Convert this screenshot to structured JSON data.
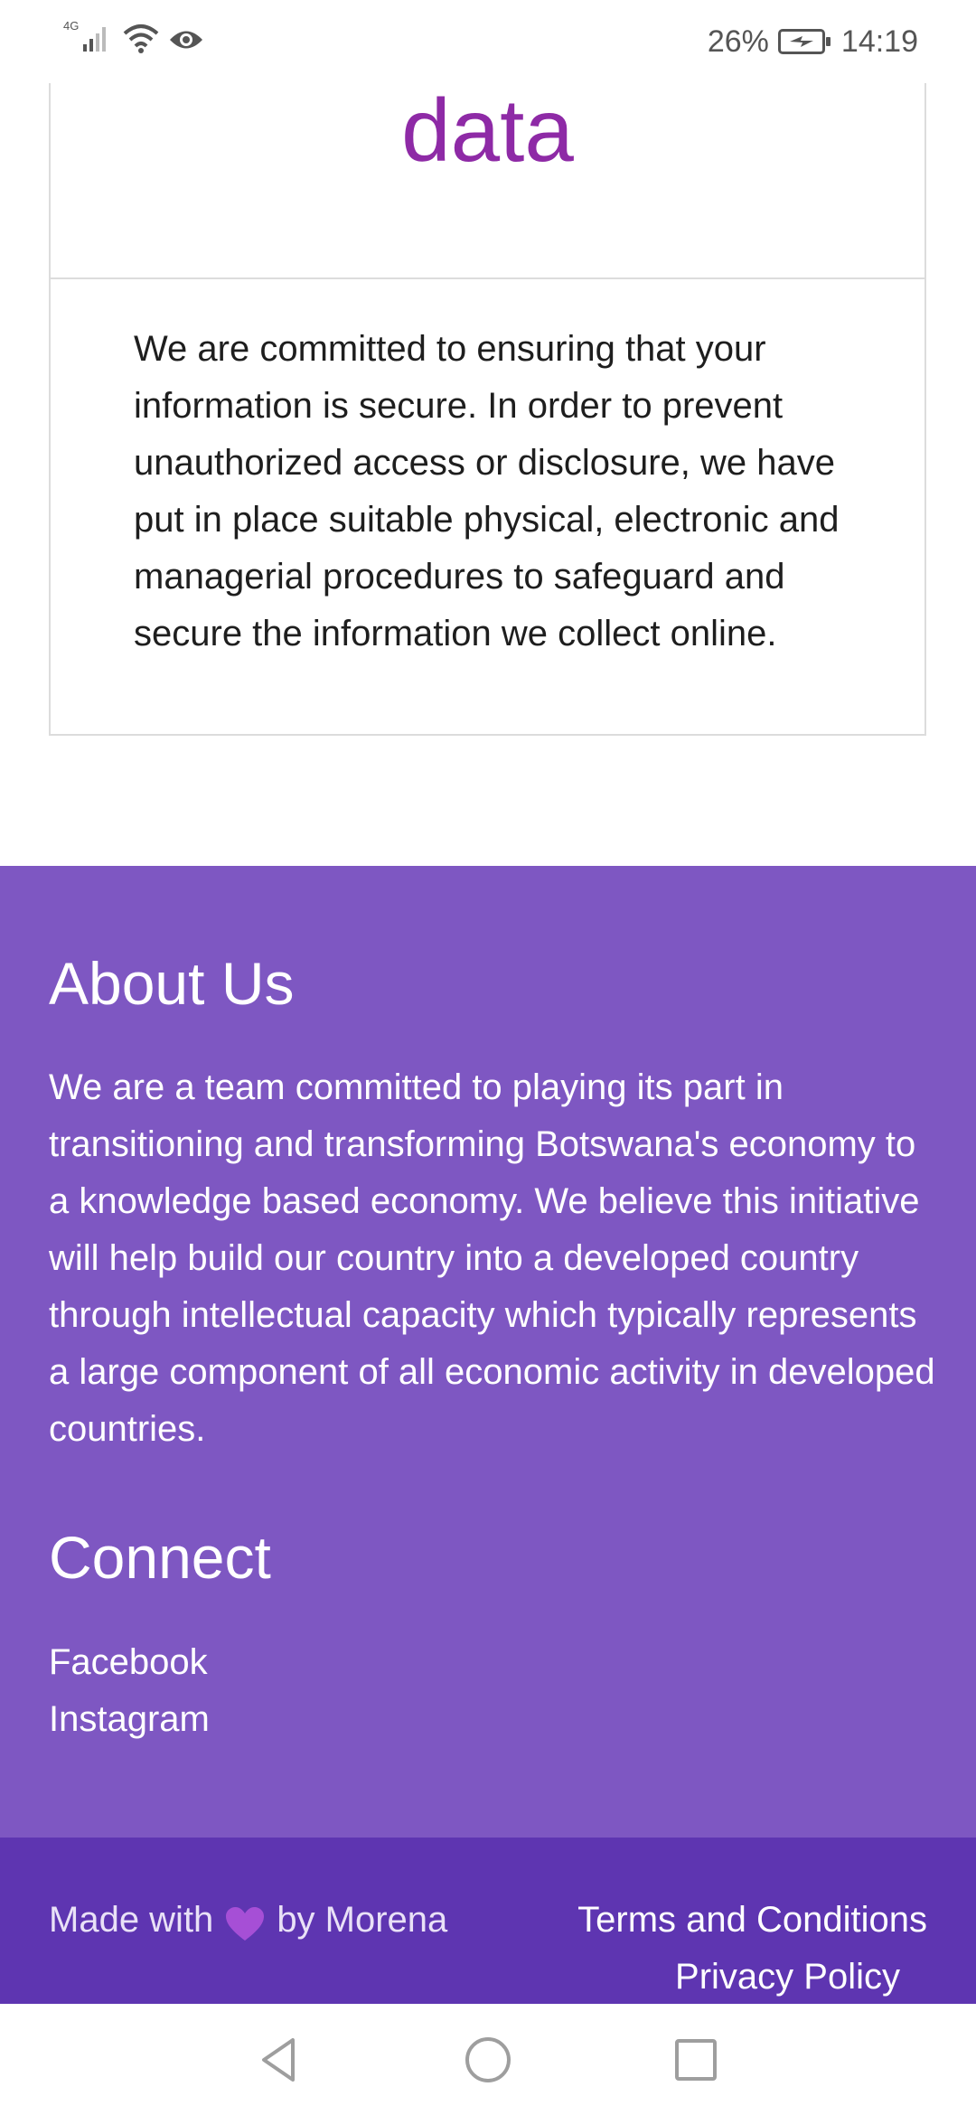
{
  "status_bar": {
    "network_label": "4G",
    "battery_percent": "26%",
    "time": "14:19"
  },
  "card": {
    "title": "How we protect your data",
    "body": "We are committed to ensuring that your information is secure. In order to prevent unauthorized access or disclosure, we have put in place suitable physical, electronic and managerial procedures to safeguard and secure the information we collect online."
  },
  "footer": {
    "about_title": "About Us",
    "about_text": "We are a team committed to playing its part in transitioning and transforming Botswana's economy to a knowledge based economy. We believe this initiative will help build our country into a developed country through intellectual capacity which typically represents a large component of all economic activity in developed countries.",
    "connect_title": "Connect",
    "links": [
      "Facebook",
      "Instagram"
    ],
    "made_with_prefix": "Made with",
    "made_with_suffix": "by Morena",
    "terms_label": "Terms and Conditions",
    "privacy_label": "Privacy Policy"
  },
  "colors": {
    "title_purple": "#8e2aa6",
    "footer_main": "#7e57c2",
    "footer_bottom": "#5e35b1",
    "heart": "#a64fd6"
  },
  "icons": [
    "signal-icon",
    "wifi-icon",
    "eye-icon",
    "battery-icon",
    "heart-icon",
    "back-icon",
    "home-icon",
    "recent-apps-icon"
  ]
}
